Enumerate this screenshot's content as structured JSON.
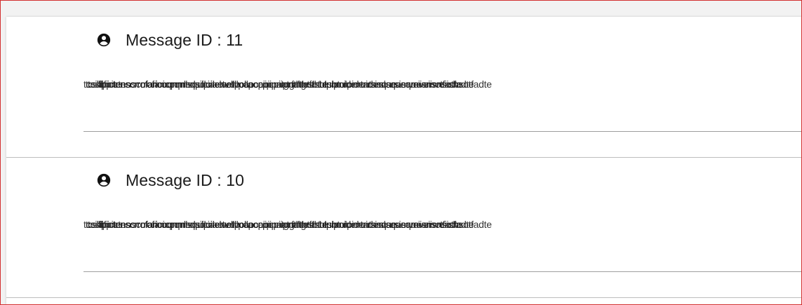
{
  "messages": [
    {
      "title": "Message ID : 11",
      "body_text": "tcsilfpictenscrrofaricoqnnrlsquilciaetvollpcaocpiipnatgrfthtesbtulpnroidentarsisqueamveiisnsotfadte"
    },
    {
      "title": "Message ID : 10",
      "body_text": "tcsilfpictenscrrofaricoqnnrlsquilciaetvollpcaocpiipnatgrfthtesbtulpnroidentarsisqueamveiisnsotfadte"
    }
  ],
  "icons": {
    "message_icon": "user-circle-icon"
  }
}
